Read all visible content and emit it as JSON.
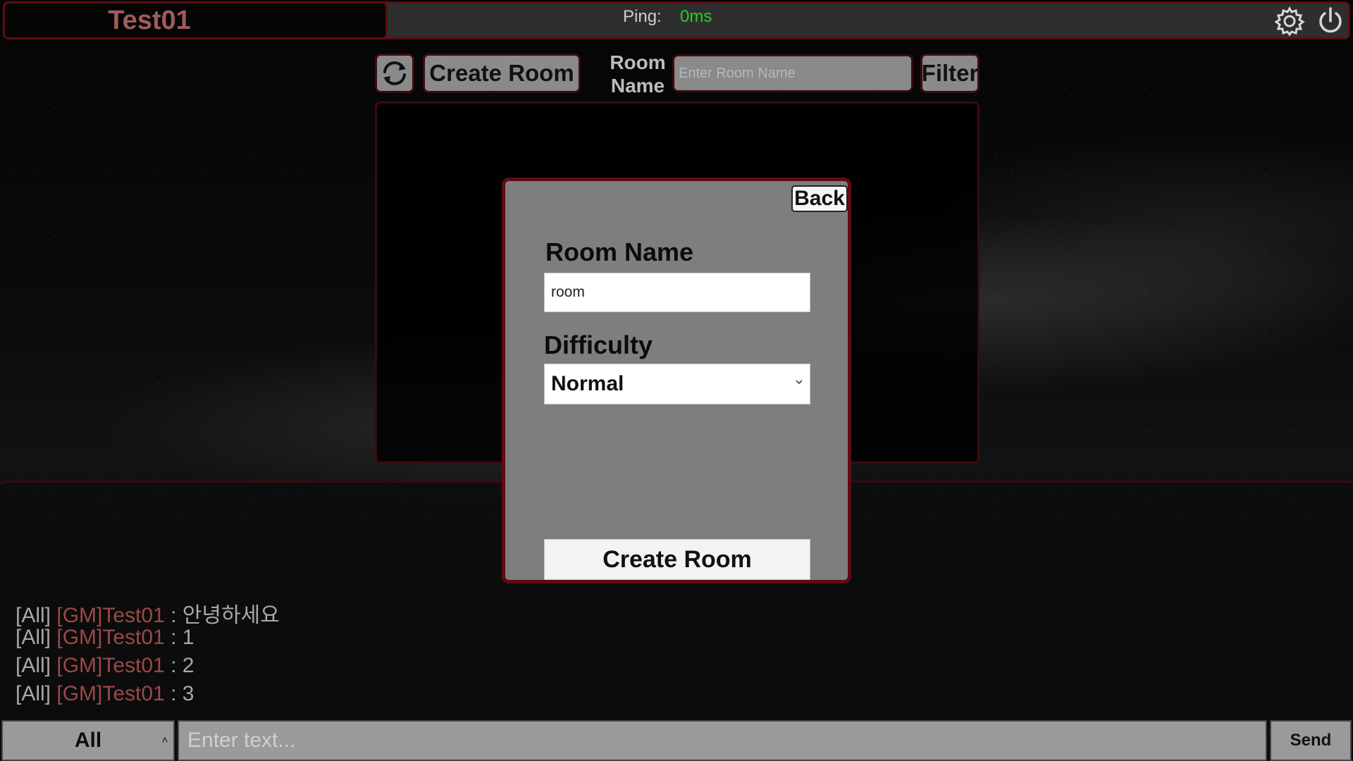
{
  "topbar": {
    "player_name": "Test01",
    "ping_label": "Ping:",
    "ping_value": "0ms",
    "icons": [
      "gear-icon",
      "power-icon"
    ]
  },
  "lobby": {
    "create_room_label": "Create Room",
    "room_name_label": "Room Name",
    "room_name_placeholder": "Enter Room Name",
    "filter_label": "Filter"
  },
  "modal": {
    "back_label": "Back",
    "room_name_label": "Room Name",
    "room_name_value": "room",
    "difficulty_label": "Difficulty",
    "difficulty_value": "Normal",
    "create_room_label": "Create Room"
  },
  "chat": {
    "messages": [
      {
        "channel": "[All]",
        "sender": "[GM]Test01",
        "text": " : 안녕하세요"
      },
      {
        "channel": "[All]",
        "sender": "[GM]Test01",
        "text": " : 1"
      },
      {
        "channel": "[All]",
        "sender": "[GM]Test01",
        "text": " : 2"
      },
      {
        "channel": "[All]",
        "sender": "[GM]Test01",
        "text": " : 3"
      }
    ],
    "channel_value": "All",
    "input_placeholder": "Enter text...",
    "send_label": "Send"
  },
  "colors": {
    "ping_ok": "#22d022",
    "border_accent": "#5e0c12",
    "gm_name": "#9b4848"
  }
}
